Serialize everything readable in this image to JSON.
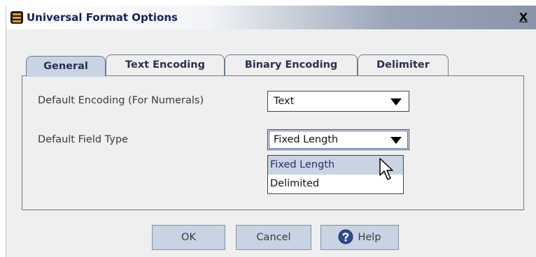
{
  "window": {
    "title": "Universal Format Options",
    "close_label": "X",
    "icon": "app-icon"
  },
  "tabs": [
    {
      "label": "General",
      "active": true
    },
    {
      "label": "Text Encoding",
      "active": false
    },
    {
      "label": "Binary Encoding",
      "active": false
    },
    {
      "label": "Delimiter",
      "active": false
    }
  ],
  "general": {
    "default_encoding": {
      "label": "Default Encoding (For Numerals)",
      "value": "Text"
    },
    "default_field_type": {
      "label": "Default Field Type",
      "value": "Fixed Length"
    },
    "field_type_options": [
      "Fixed Length",
      "Delimited"
    ],
    "highlighted_option": "Fixed Length"
  },
  "buttons": {
    "ok": "OK",
    "cancel": "Cancel",
    "help": "Help"
  },
  "colors": {
    "tab_active_bg": "#c8d4e3",
    "button_bg": "#c8d4e3",
    "dialog_bg": "#efefef",
    "title_text": "#1a1e5e"
  }
}
